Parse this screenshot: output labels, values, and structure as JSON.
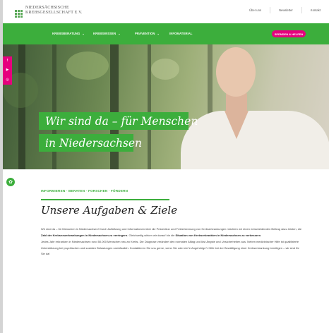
{
  "header": {
    "logo_line1": "Niedersächsische",
    "logo_line2": "Krebsgesellschaft e.V.",
    "top_links": [
      "Über uns",
      "Newsletter",
      "Kontakt"
    ]
  },
  "nav": {
    "items": [
      "KREBSBERATUNG",
      "KREBSWISSEN",
      "PRÄVENTION",
      "INFOMATERIAL"
    ],
    "donate_label": "SPENDEN & HELFEN"
  },
  "hero": {
    "claim_line1": "Wir sind da – für Menschen",
    "claim_line2": "in Niedersachsen"
  },
  "social": {
    "icons": [
      "facebook-icon",
      "youtube-icon",
      "instagram-icon"
    ],
    "glyphs": [
      "f",
      "▶",
      "◎"
    ]
  },
  "badge": {
    "glyph": "✿"
  },
  "content": {
    "tagline": "INFORMIEREN · BERATEN · FORSCHEN · FÖRDERN",
    "heading": "Unsere Aufgaben & Ziele",
    "para1_a": "Wir sind da – für Menschen in Niedersachsen! Durch Aufklärung und Informationen über die Prävention und Früherkennung von Krebserkrankungen möchten wir einen entscheidenden Beitrag dazu leisten, die ",
    "para1_b": "Zahl der Krebsneuerkrankungen in Niedersachsen zu verringern",
    "para1_c": ". Gleichzeitig wirken wir darauf hin die ",
    "para1_d": "Situation von Krebserkrankten in Niedersachsen zu verbessern",
    "para1_e": ".",
    "para2": "Jedes Jahr erkranken in Niedersachsen rund 50.000 Menschen neu an Krebs. Die Diagnose verändert den normalen Alltag und löst Ängste und Unsicherheiten aus. Neben medizinischer Hilfe ist qualifizierte Unterstützung bei psychischen und sozialen Belastungen unerlässlich. Kontaktieren Sie uns gerne, wenn Sie oder ein*e Angehörige*r Hilfe bei der Bewältigung einer Krebserkrankung benötigen – wir sind für Sie da!"
  },
  "colors": {
    "brand_green": "#3cae3c",
    "accent_pink": "#e6007e"
  }
}
